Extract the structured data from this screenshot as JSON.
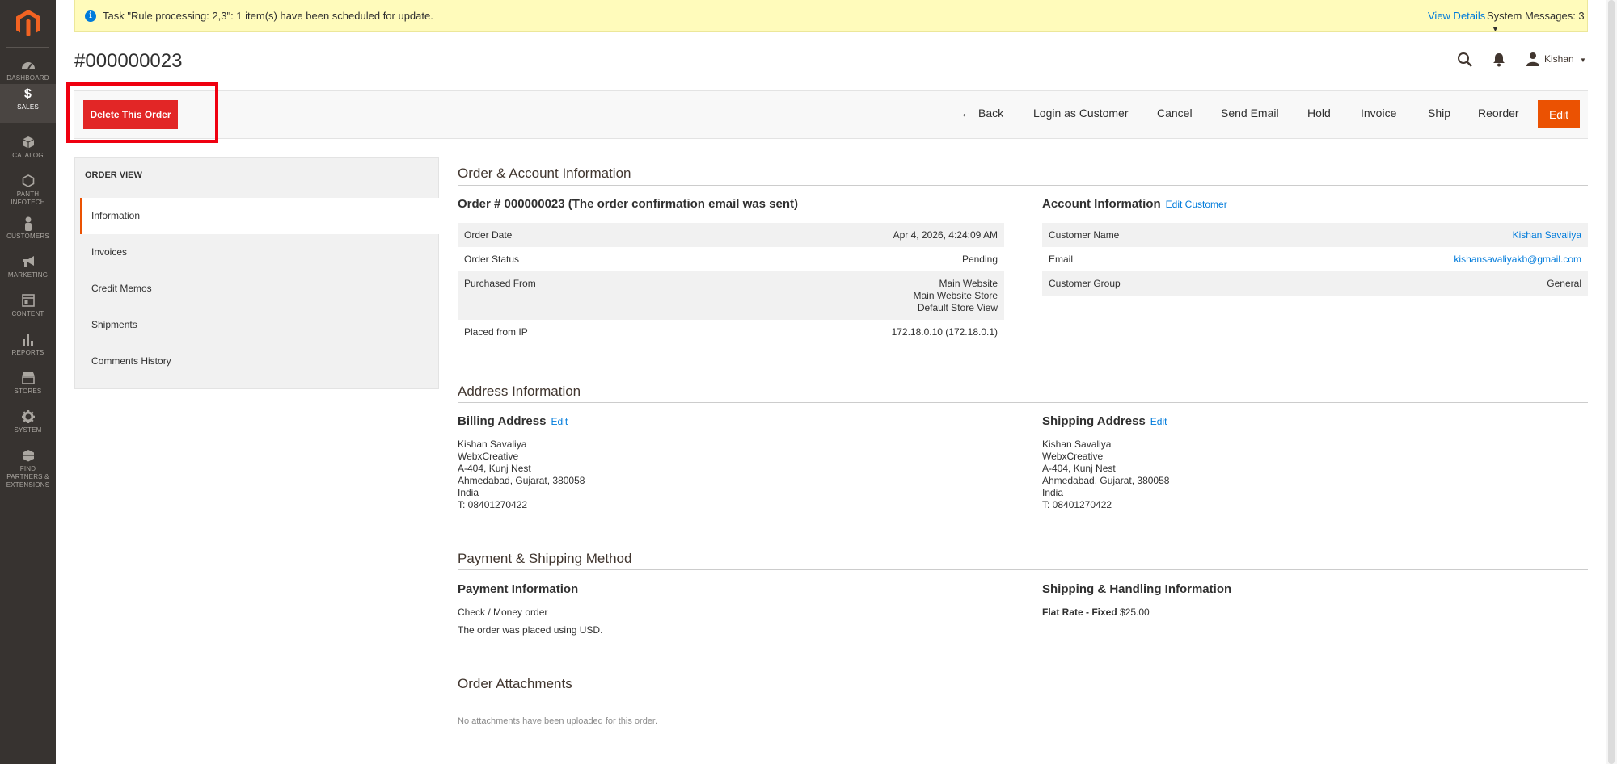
{
  "sidebar": {
    "items": [
      {
        "label": "DASHBOARD"
      },
      {
        "label": "SALES"
      },
      {
        "label": "CATALOG"
      },
      {
        "label": "PANTH INFOTECH"
      },
      {
        "label": "CUSTOMERS"
      },
      {
        "label": "MARKETING"
      },
      {
        "label": "CONTENT"
      },
      {
        "label": "REPORTS"
      },
      {
        "label": "STORES"
      },
      {
        "label": "SYSTEM"
      },
      {
        "label": "FIND PARTNERS & EXTENSIONS"
      }
    ]
  },
  "message": {
    "text": "Task \"Rule processing: 2,3\": 1 item(s) have been scheduled for update.",
    "view_details": "View Details",
    "system_messages": "System Messages: 3"
  },
  "header": {
    "title": "#000000023",
    "user": "Kishan"
  },
  "actions": {
    "delete": "Delete This Order",
    "back": "Back",
    "login_as_customer": "Login as Customer",
    "cancel": "Cancel",
    "send_email": "Send Email",
    "hold": "Hold",
    "invoice": "Invoice",
    "ship": "Ship",
    "reorder": "Reorder",
    "edit": "Edit"
  },
  "tabs": {
    "title": "ORDER VIEW",
    "items": [
      "Information",
      "Invoices",
      "Credit Memos",
      "Shipments",
      "Comments History"
    ]
  },
  "order_account": {
    "title": "Order & Account Information",
    "order_heading": "Order # 000000023 (The order confirmation email was sent)",
    "order_rows": [
      {
        "key": "Order Date",
        "value": "Apr 4, 2026, 4:24:09 AM"
      },
      {
        "key": "Order Status",
        "value": "Pending"
      },
      {
        "key": "Purchased From",
        "value_lines": [
          "Main Website",
          "Main Website Store",
          "Default Store View"
        ]
      },
      {
        "key": "Placed from IP",
        "value": "172.18.0.10 (172.18.0.1)"
      }
    ],
    "account_heading": "Account Information",
    "account_link": "Edit Customer",
    "account_rows": [
      {
        "key": "Customer Name",
        "value": "Kishan Savaliya"
      },
      {
        "key": "Email",
        "value": "kishansavaliyakb@gmail.com"
      },
      {
        "key": "Customer Group",
        "value": "General"
      }
    ]
  },
  "address": {
    "title": "Address Information",
    "billing_heading": "Billing Address",
    "shipping_heading": "Shipping Address",
    "edit_link": "Edit",
    "billing_lines": [
      "Kishan Savaliya",
      "WebxCreative",
      "A-404, Kunj Nest",
      "Ahmedabad, Gujarat, 380058",
      "India",
      "T: 08401270422"
    ],
    "shipping_lines": [
      "Kishan Savaliya",
      "WebxCreative",
      "A-404, Kunj Nest",
      "Ahmedabad, Gujarat, 380058",
      "India",
      "T: 08401270422"
    ]
  },
  "payment_shipping": {
    "title": "Payment & Shipping Method",
    "payment_heading": "Payment Information",
    "payment_method": "Check / Money order",
    "payment_note": "The order was placed using USD.",
    "shipping_heading": "Shipping & Handling Information",
    "shipping_method": "Flat Rate - Fixed",
    "shipping_price": "$25.00"
  },
  "attachments": {
    "title": "Order Attachments",
    "empty_note": "No attachments have been uploaded for this order."
  },
  "colors": {
    "sidebar_bg": "#373330",
    "accent_orange": "#eb5202",
    "delete_red": "#e22626",
    "link_blue": "#007bdb",
    "message_bg": "#fffbbb"
  }
}
